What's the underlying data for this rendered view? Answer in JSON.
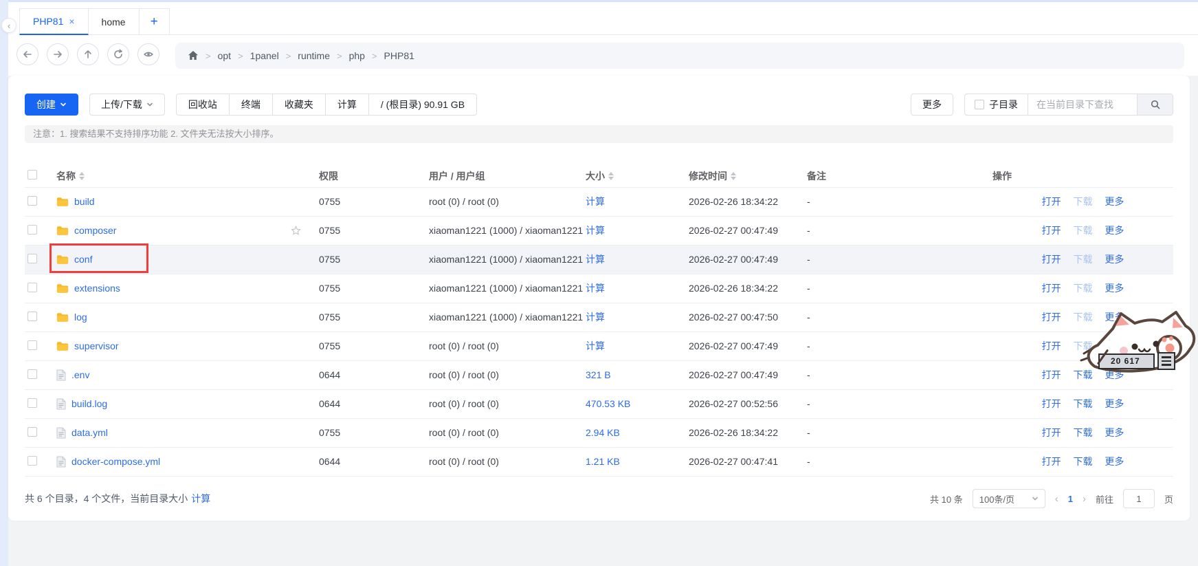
{
  "tabs": [
    {
      "label": "PHP81",
      "active": true,
      "closable": true
    },
    {
      "label": "home",
      "active": false,
      "closable": false
    }
  ],
  "icons": {
    "close": "×",
    "plus": "+",
    "collapse": "‹",
    "pager_prev": "‹",
    "pager_next": "›"
  },
  "breadcrumb": [
    "opt",
    "1panel",
    "runtime",
    "php",
    "PHP81"
  ],
  "toolbar": {
    "create": "创建",
    "upload_download": "上传/下载",
    "group": [
      "回收站",
      "终端",
      "收藏夹",
      "计算",
      "/ (根目录) 90.91 GB"
    ],
    "more": "更多",
    "subdir": "子目录",
    "search_placeholder": "在当前目录下查找"
  },
  "notice": "注意：1. 搜索结果不支持排序功能 2. 文件夹无法按大小排序。",
  "table": {
    "headers": {
      "name": "名称",
      "perm": "权限",
      "user": "用户 / 用户组",
      "size": "大小",
      "mtime": "修改时间",
      "note": "备注",
      "action": "操作"
    },
    "actions": {
      "open": "打开",
      "download": "下载",
      "more": "更多"
    },
    "rows": [
      {
        "name": "build",
        "type": "dir",
        "perm": "0755",
        "user": "root (0) / root (0)",
        "size": "计算",
        "mtime": "2026-02-26 18:34:22",
        "note": "-",
        "starred": false,
        "highlight": false
      },
      {
        "name": "composer",
        "type": "dir",
        "perm": "0755",
        "user": "xiaoman1221 (1000) / xiaoman1221",
        "size": "计算",
        "mtime": "2026-02-27 00:47:49",
        "note": "-",
        "starred": true,
        "highlight": false
      },
      {
        "name": "conf",
        "type": "dir",
        "perm": "0755",
        "user": "xiaoman1221 (1000) / xiaoman1221",
        "size": "计算",
        "mtime": "2026-02-27 00:47:49",
        "note": "-",
        "starred": false,
        "highlight": true
      },
      {
        "name": "extensions",
        "type": "dir",
        "perm": "0755",
        "user": "xiaoman1221 (1000) / xiaoman1221",
        "size": "计算",
        "mtime": "2026-02-26 18:34:22",
        "note": "-",
        "starred": false,
        "highlight": false
      },
      {
        "name": "log",
        "type": "dir",
        "perm": "0755",
        "user": "xiaoman1221 (1000) / xiaoman1221",
        "size": "计算",
        "mtime": "2026-02-27 00:47:50",
        "note": "-",
        "starred": false,
        "highlight": false
      },
      {
        "name": "supervisor",
        "type": "dir",
        "perm": "0755",
        "user": "root (0) / root (0)",
        "size": "计算",
        "mtime": "2026-02-27 00:47:49",
        "note": "-",
        "starred": false,
        "highlight": false
      },
      {
        "name": ".env",
        "type": "file",
        "perm": "0644",
        "user": "root (0) / root (0)",
        "size": "321 B",
        "mtime": "2026-02-27 00:47:49",
        "note": "-",
        "starred": false,
        "highlight": false
      },
      {
        "name": "build.log",
        "type": "file",
        "perm": "0644",
        "user": "root (0) / root (0)",
        "size": "470.53 KB",
        "mtime": "2026-02-27 00:52:56",
        "note": "-",
        "starred": false,
        "highlight": false
      },
      {
        "name": "data.yml",
        "type": "file",
        "perm": "0755",
        "user": "root (0) / root (0)",
        "size": "2.94 KB",
        "mtime": "2026-02-26 18:34:22",
        "note": "-",
        "starred": false,
        "highlight": false
      },
      {
        "name": "docker-compose.yml",
        "type": "file",
        "perm": "0644",
        "user": "root (0) / root (0)",
        "size": "1.21 KB",
        "mtime": "2026-02-27 00:47:41",
        "note": "-",
        "starred": false,
        "highlight": false
      }
    ]
  },
  "footer": {
    "summary": "共 6 个目录，4 个文件，当前目录大小",
    "calc": "计算",
    "total": "共 10 条",
    "page_size": "100条/页",
    "current_page": "1",
    "goto_label": "前往",
    "goto_value": "1",
    "page_unit": "页"
  },
  "overlay": {
    "counter": "20 617"
  },
  "colors": {
    "primary": "#1765f3",
    "link": "#2d6ce8",
    "link_disabled": "#a7c3f5",
    "folder": "#f8ba2a",
    "highlight_border": "#f23c3c"
  }
}
